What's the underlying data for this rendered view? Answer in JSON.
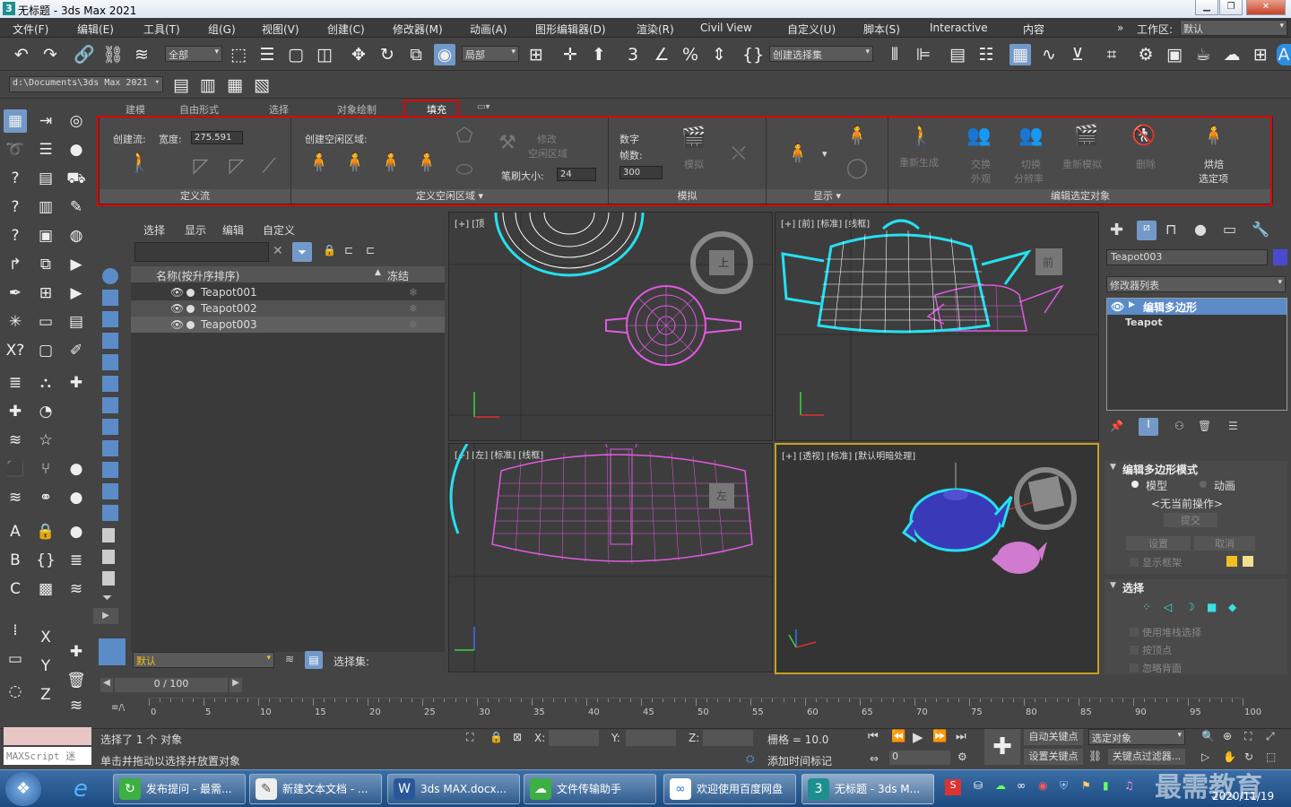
{
  "window": {
    "title": "无标题 - 3ds Max 2021",
    "app_icon": "3"
  },
  "menu": [
    "文件(F)",
    "编辑(E)",
    "工具(T)",
    "组(G)",
    "视图(V)",
    "创建(C)",
    "修改器(M)",
    "动画(A)",
    "图形编辑器(D)",
    "渲染(R)",
    "Civil View",
    "自定义(U)",
    "脚本(S)",
    "Interactive",
    "内容"
  ],
  "workspace": {
    "label": "工作区:",
    "value": "默认"
  },
  "toolbar": {
    "filter": "全部",
    "coord": "局部",
    "selset": "创建选择集"
  },
  "path": {
    "value": "d:\\Documents\\3ds Max 2021"
  },
  "ribbon_tabs": [
    "建模",
    "自由形式",
    "选择",
    "对象绘制",
    "填充"
  ],
  "ribbon": {
    "flow_label": "创建流:",
    "width_label": "宽度:",
    "width_value": "275.591",
    "flow_footer": "定义流",
    "idle_label": "创建空闲区域:",
    "idle_footer": "定义空闲区域",
    "modify_label1": "修改",
    "modify_label2": "空闲区域",
    "brush_label": "笔刷大小:",
    "brush_value": "24",
    "digits_label": "数字",
    "frames_label": "帧数:",
    "frames_value": "300",
    "simulate_label": "模拟",
    "sim_footer": "模拟",
    "display_footer": "显示",
    "regen_label": "重新生成",
    "swap_label1": "交换",
    "swap_label2": "外观",
    "switch_label1": "切换",
    "switch_label2": "分辨率",
    "resim_label": "重新模拟",
    "delete_label": "删除",
    "bake_label1": "烘焙",
    "bake_label2": "选定项",
    "edit_footer": "编辑选定对象"
  },
  "explorer": {
    "tabs": [
      "选择",
      "显示",
      "编辑",
      "自定义"
    ],
    "col_name": "名称(按升序排序)",
    "col_freeze": "冻结",
    "rows": [
      "Teapot001",
      "Teapot002",
      "Teapot003"
    ],
    "layer": "默认",
    "selset_label": "选择集:"
  },
  "viewports": {
    "top": "[+] [顶",
    "front": "[+] [前] [标准] [线框]",
    "left": "[+] [左] [标准] [线框]",
    "persp": "[+] [透视] [标准] [默认明暗处理]",
    "cube_top": "上",
    "cube_front": "前",
    "cube_left": "左"
  },
  "cmd": {
    "object_name": "Teapot003",
    "modifier_list": "修改器列表",
    "stack_items": [
      "编辑多边形",
      "Teapot"
    ],
    "rollout1": "编辑多边形模式",
    "mode_model": "模型",
    "mode_anim": "动画",
    "no_op": "<无当前操作>",
    "commit": "提交",
    "settings": "设置",
    "cancel": "取消",
    "show_cage": "显示框架",
    "rollout2": "选择",
    "use_stack": "使用堆栈选择",
    "by_vertex": "按顶点",
    "ignore_back": "忽略背面"
  },
  "timeline": {
    "frame": "0 / 100",
    "ticks": [
      "0",
      "5",
      "10",
      "15",
      "20",
      "25",
      "30",
      "35",
      "40",
      "45",
      "50",
      "55",
      "60",
      "65",
      "70",
      "75",
      "80",
      "85",
      "90",
      "95",
      "100"
    ]
  },
  "status": {
    "maxscript": "MAXScript 迷",
    "selected": "选择了 1 个 对象",
    "hint": "单击并拖动以选择并放置对象",
    "x_label": "X:",
    "y_label": "Y:",
    "z_label": "Z:",
    "grid": "栅格 = 10.0",
    "add_tag": "添加时间标记",
    "auto_key": "自动关键点",
    "sel_obj": "选定对象",
    "set_key": "设置关键点",
    "key_filter": "关键点过滤器...",
    "frame_field": "0"
  },
  "taskbar": {
    "items": [
      "发布提问 - 最需...",
      "新建文本文档 - ...",
      "3ds MAX.docx...",
      "文件传输助手",
      "欢迎使用百度网盘",
      "无标题 - 3ds M..."
    ],
    "clock": "2020/11/19",
    "watermark": "最需教育"
  },
  "colors": {
    "select_red": "#e00000",
    "teapot_pink": "#d94fd9",
    "teapot_blue": "#3a3ab8",
    "sel_outline": "#25e0f0"
  }
}
